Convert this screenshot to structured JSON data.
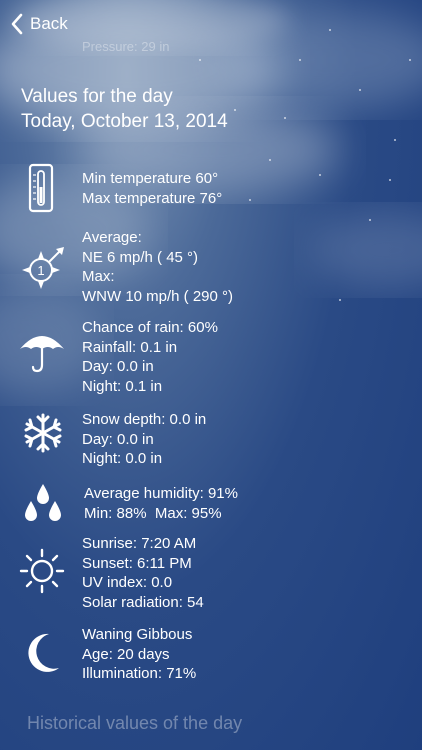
{
  "nav": {
    "back_label": "Back"
  },
  "faded_top": "Pressure: 29 in",
  "header": {
    "line1": "Values for the day",
    "line2": "Today, October 13, 2014"
  },
  "temperature": {
    "min": "Min temperature 60°",
    "max": "Max temperature 76°",
    "icon": "thermometer-icon"
  },
  "wind": {
    "icon": "compass-icon",
    "compass_number": "1",
    "lines": [
      "Average:",
      "NE 6 mp/h ( 45 °)",
      "Max:",
      "WNW 10 mp/h ( 290 °)"
    ]
  },
  "rain": {
    "icon": "umbrella-icon",
    "lines": [
      "Chance of rain: 60%",
      "Rainfall: 0.1 in",
      "Day: 0.0 in",
      "Night: 0.1 in"
    ]
  },
  "snow": {
    "icon": "snowflake-icon",
    "lines": [
      "Snow depth: 0.0 in",
      "Day: 0.0 in",
      "Night: 0.0 in"
    ]
  },
  "humidity": {
    "icon": "droplets-icon",
    "average": "Average humidity: 91%",
    "min": "Min: 88%",
    "max": "Max: 95%"
  },
  "sun": {
    "icon": "sun-icon",
    "lines": [
      "Sunrise: 7:20 AM",
      "Sunset: 6:11 PM",
      "UV index: 0.0",
      "Solar radiation: 54"
    ]
  },
  "moon": {
    "icon": "moon-icon",
    "lines": [
      "Waning Gibbous",
      "Age: 20 days",
      "Illumination: 71%"
    ]
  },
  "footer": "Historical values of the day"
}
